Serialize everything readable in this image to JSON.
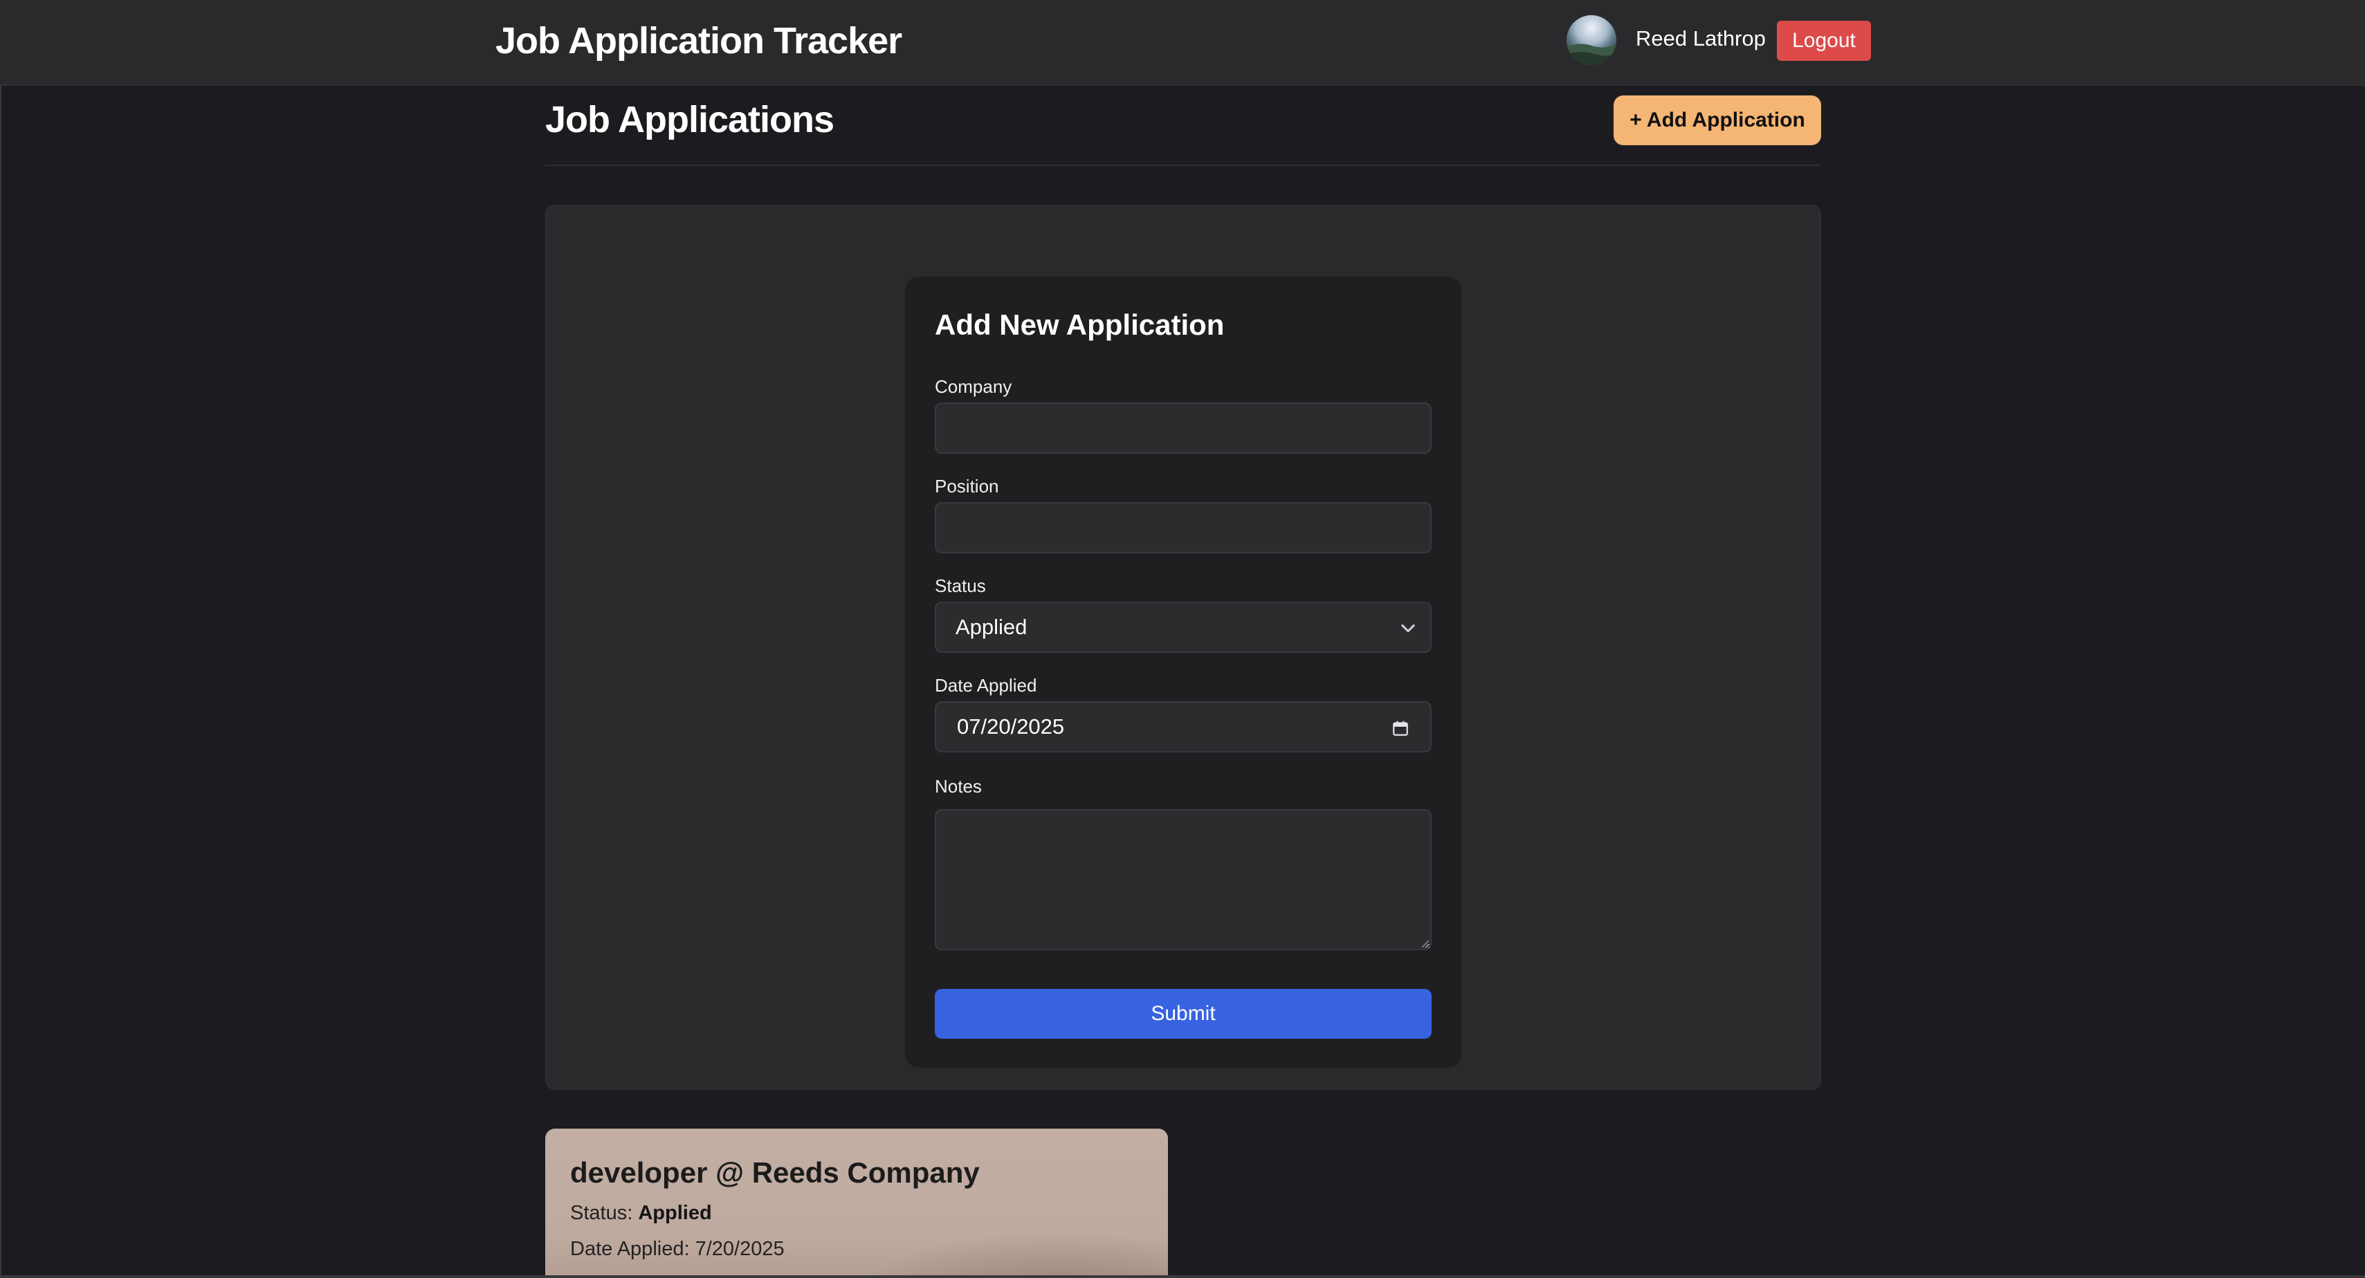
{
  "header": {
    "app_title": "Job Application Tracker",
    "user_name": "Reed Lathrop",
    "logout_label": "Logout",
    "avatar_icon": "user-avatar"
  },
  "main": {
    "page_title": "Job Applications",
    "add_button_label": "+ Add Application"
  },
  "form": {
    "title": "Add New Application",
    "company_label": "Company",
    "company_value": "",
    "position_label": "Position",
    "position_value": "",
    "status_label": "Status",
    "status_value": "Applied",
    "date_label": "Date Applied",
    "date_value": "07/20/2025",
    "notes_label": "Notes",
    "notes_value": "",
    "submit_label": "Submit"
  },
  "applications": [
    {
      "title": "developer @ Reeds Company",
      "status_label": "Status:",
      "status_value": "Applied",
      "date_text": "Date Applied: 7/20/2025"
    }
  ],
  "colors": {
    "background": "#1c1c20",
    "header": "#2a2a2c",
    "accent_add": "#f5b574",
    "logout": "#dd4a4a",
    "submit": "#3863e0",
    "card": "#c2aea3"
  }
}
